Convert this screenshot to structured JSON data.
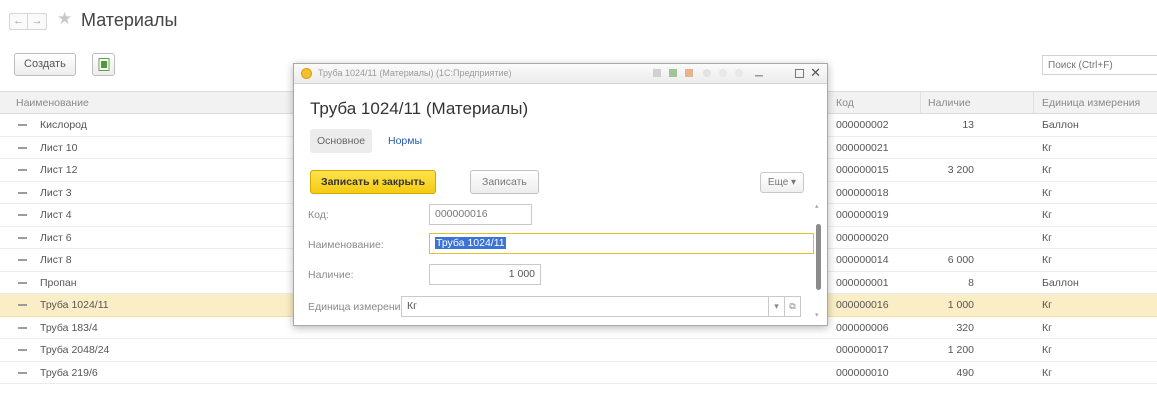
{
  "header": {
    "back_icon": "←",
    "forward_icon": "→",
    "favorite_icon": "★",
    "title": "Материалы"
  },
  "toolbar": {
    "create_label": "Создать",
    "search_placeholder": "Поиск (Ctrl+F)"
  },
  "table": {
    "columns": {
      "name": "Наименование",
      "code": "Код",
      "qty": "Наличие",
      "unit": "Единица измерения"
    },
    "rows": [
      {
        "name": "Кислород",
        "code": "000000002",
        "qty": "13",
        "unit": "Баллон"
      },
      {
        "name": "Лист 10",
        "code": "000000021",
        "qty": "",
        "unit": "Кг"
      },
      {
        "name": "Лист 12",
        "code": "000000015",
        "qty": "3 200",
        "unit": "Кг"
      },
      {
        "name": "Лист 3",
        "code": "000000018",
        "qty": "",
        "unit": "Кг"
      },
      {
        "name": "Лист 4",
        "code": "000000019",
        "qty": "",
        "unit": "Кг"
      },
      {
        "name": "Лист 6",
        "code": "000000020",
        "qty": "",
        "unit": "Кг"
      },
      {
        "name": "Лист 8",
        "code": "000000014",
        "qty": "6 000",
        "unit": "Кг"
      },
      {
        "name": "Пропан",
        "code": "000000001",
        "qty": "8",
        "unit": "Баллон"
      },
      {
        "name": "Труба 1024/11",
        "code": "000000016",
        "qty": "1 000",
        "unit": "Кг"
      },
      {
        "name": "Труба 183/4",
        "code": "000000006",
        "qty": "320",
        "unit": "Кг"
      },
      {
        "name": "Труба 2048/24",
        "code": "000000017",
        "qty": "1 200",
        "unit": "Кг"
      },
      {
        "name": "Труба 219/6",
        "code": "000000010",
        "qty": "490",
        "unit": "Кг"
      }
    ],
    "selected_row": 8
  },
  "modal": {
    "window_title": "Труба 1024/11 (Материалы) (1С:Предприятие)",
    "heading": "Труба 1024/11 (Материалы)",
    "tabs": {
      "main": "Основное",
      "norms": "Нормы"
    },
    "buttons": {
      "save_close": "Записать и закрыть",
      "save": "Записать",
      "more": "Еще ▾"
    },
    "fields": {
      "code_label": "Код:",
      "code_value": "000000016",
      "name_label": "Наименование:",
      "name_value": "Труба 1024/11",
      "qty_label": "Наличие:",
      "qty_value": "1 000",
      "unit_label": "Единица измерения:",
      "unit_value": "Кг"
    }
  },
  "colors": {
    "accent_yellow": "#f5cb12",
    "selected_row": "#fbeec6",
    "link_blue": "#2a59b3"
  }
}
